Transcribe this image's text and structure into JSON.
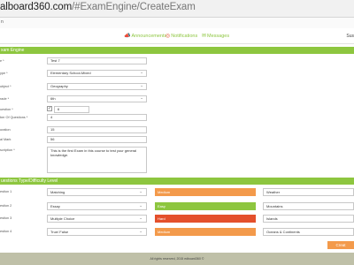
{
  "browser": {
    "url_host": "alboard360.com",
    "url_path": "/#ExamEngine/CreateExam"
  },
  "topstrip": {
    "mark": "n"
  },
  "nav": {
    "announcements": "Announcements",
    "notifications": "Notifications",
    "messages": "Messages",
    "user": "Sus"
  },
  "colors": {
    "accent": "#8dc63f",
    "medium": "#f39a4b",
    "easy": "#8dc63f",
    "hard": "#e4502c",
    "footer": "#bfc0a8"
  },
  "exam_section": {
    "title": "xam Engine",
    "fields": [
      {
        "label": "e *",
        "value": "Test 7",
        "type": "text"
      },
      {
        "label": "ype *",
        "value": "Elementary School-Mixed",
        "type": "select"
      },
      {
        "label": "ubject *",
        "value": "Geography",
        "type": "select"
      },
      {
        "label": "rade *",
        "value": "6th",
        "type": "select"
      },
      {
        "label": "uestion *",
        "value": "6",
        "type": "check"
      },
      {
        "label": "ber Of Questions *",
        "value": "4",
        "type": "text"
      },
      {
        "label": "uration",
        "value": "15",
        "type": "text"
      },
      {
        "label": "al Mark",
        "value": "56",
        "type": "text"
      },
      {
        "label": "scription *",
        "value": "This is the first Exam in this course to test your general knowledge.",
        "type": "textarea"
      }
    ]
  },
  "questions_section": {
    "title": "uestions Type/Difficulty Level",
    "rows": [
      {
        "label": "estion 1",
        "type": "Matching",
        "difficulty": "Medium",
        "difficulty_color": "#f39a4b",
        "topic": "Weather"
      },
      {
        "label": "estion 2",
        "type": "Essay",
        "difficulty": "Easy",
        "difficulty_color": "#8dc63f",
        "topic": "Mountains"
      },
      {
        "label": "estion 3",
        "type": "Multiple Choice",
        "difficulty": "Hard",
        "difficulty_color": "#e4502c",
        "topic": "Islands"
      },
      {
        "label": "estion 4",
        "type": "True/ False",
        "difficulty": "Medium",
        "difficulty_color": "#f39a4b",
        "topic": "Oceans & Continents"
      }
    ]
  },
  "actions": {
    "create": "Creat"
  },
  "footer": {
    "text": "All rights reserved, 2015 edboard360 ©"
  }
}
